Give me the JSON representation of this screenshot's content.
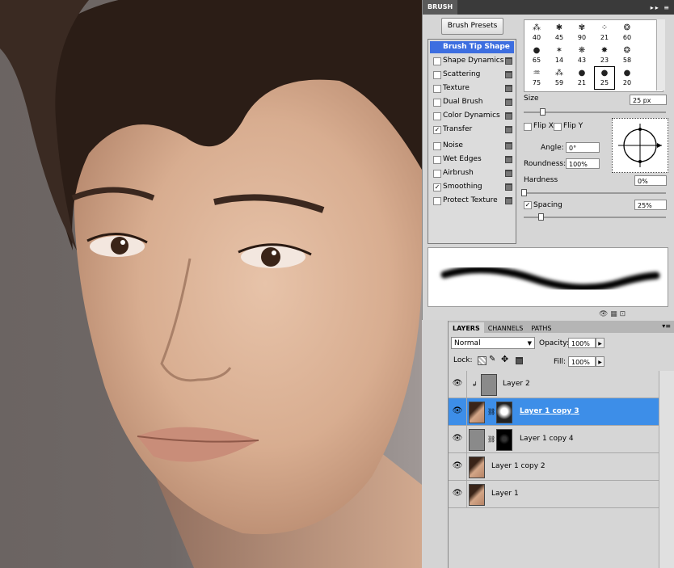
{
  "brush_panel": {
    "tab": "BRUSH",
    "menu_icons": "▸▸ ≡",
    "presets_button": "Brush Presets",
    "options": [
      {
        "label": "Brush Tip Shape",
        "checked": null,
        "selected": true
      },
      {
        "label": "Shape Dynamics",
        "checked": false
      },
      {
        "label": "Scattering",
        "checked": false
      },
      {
        "label": "Texture",
        "checked": false
      },
      {
        "label": "Dual Brush",
        "checked": false
      },
      {
        "label": "Color Dynamics",
        "checked": false
      },
      {
        "label": "Transfer",
        "checked": true
      },
      {
        "label": "Noise",
        "checked": false
      },
      {
        "label": "Wet Edges",
        "checked": false
      },
      {
        "label": "Airbrush",
        "checked": false
      },
      {
        "label": "Smoothing",
        "checked": true
      },
      {
        "label": "Protect Texture",
        "checked": false
      }
    ],
    "tip_sizes": [
      "40",
      "45",
      "90",
      "21",
      "60",
      "65",
      "14",
      "43",
      "23",
      "58",
      "75",
      "59",
      "21",
      "25",
      "20"
    ],
    "tip_glyphs": [
      "⁂",
      "✱",
      "✾",
      "⁘",
      "❂",
      "●",
      "✶",
      "❋",
      "✸",
      "❂",
      "♒",
      "⁂",
      "●",
      "●",
      "●"
    ],
    "selected_tip_index": 13,
    "size_label": "Size",
    "size_value": "25 px",
    "flip_x": "Flip X",
    "flip_y": "Flip Y",
    "angle_label": "Angle:",
    "angle_value": "0°",
    "roundness_label": "Roundness:",
    "roundness_value": "100%",
    "hardness_label": "Hardness",
    "hardness_value": "0%",
    "spacing_label": "Spacing",
    "spacing_checked": true,
    "spacing_value": "25%",
    "size_slider_fraction": 0.13,
    "hardness_slider_fraction": 0.0,
    "spacing_slider_fraction": 0.12,
    "footer_icons": "👁 ▦ ⊡"
  },
  "layers_panel": {
    "tabs": [
      "LAYERS",
      "CHANNELS",
      "PATHS"
    ],
    "menu_icon": "▾≡",
    "blend_mode": "Normal",
    "opacity_label": "Opacity:",
    "opacity_value": "100%",
    "lock_label": "Lock:",
    "fill_label": "Fill:",
    "fill_value": "100%",
    "layers": [
      {
        "name": "Layer 2",
        "selected": false
      },
      {
        "name": "Layer 1 copy 3",
        "selected": true
      },
      {
        "name": "Layer 1 copy 4",
        "selected": false
      },
      {
        "name": "Layer 1 copy 2",
        "selected": false
      },
      {
        "name": "Layer 1",
        "selected": false
      }
    ]
  },
  "colors": {
    "selection_blue": "#3d8ee8",
    "option_selected": "#3d6ee0",
    "panel_bg": "#d6d6d6"
  }
}
